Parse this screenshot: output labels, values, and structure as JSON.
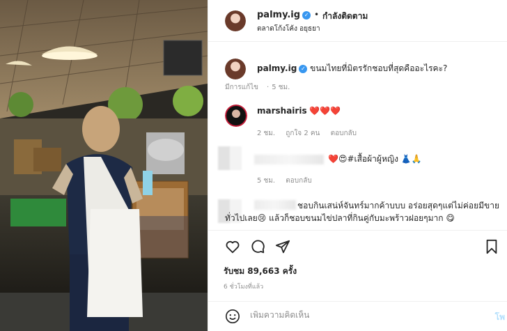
{
  "header": {
    "username": "palmy.ig",
    "separator": "•",
    "follow_state": "กำลังติดตาม",
    "location": "ตลาดโก้งโค้ง อยุธยา"
  },
  "caption": {
    "username": "palmy.ig",
    "text": "ขนมไทยที่มิตรรักชอบที่สุดคืออะไรคะ?",
    "edited": "มีการแก้ไข",
    "time": "5 ชม."
  },
  "comments": [
    {
      "username": "marshairis",
      "text": "❤️❤️❤️",
      "time": "2 ชม.",
      "likes": "ถูกใจ 2 คน",
      "reply": "ตอบกลับ"
    },
    {
      "username": "",
      "text": "❤️😍#เสื้อผ้าผู้หญิง 👗🙏",
      "time": "5 ชม.",
      "reply": "ตอบกลับ"
    },
    {
      "username": "",
      "text_line1": "ชอบกินเสน่ห์จันทร์มากค้าบบบ อร่อยสุดๆแต่ไม่ค่อยมีขาย",
      "text_line2": "ทั่วไปเลย😢 แล้วก็ชอบขนมไข่ปลาที่กินคู่กับมะพร้าวฝอยๆมาก 😋"
    }
  ],
  "actions": {
    "like_icon": "heart-icon",
    "comment_icon": "comment-icon",
    "share_icon": "share-icon",
    "save_icon": "bookmark-icon"
  },
  "stats": {
    "views_label": "รับชม 89,663 ครั้ง",
    "time_ago": "6 ชั่วโมงที่แล้ว"
  },
  "add_comment": {
    "emoji_icon": "emoji-icon",
    "placeholder": "เพิ่มความคิดเห็น",
    "post_label": "โพ"
  }
}
